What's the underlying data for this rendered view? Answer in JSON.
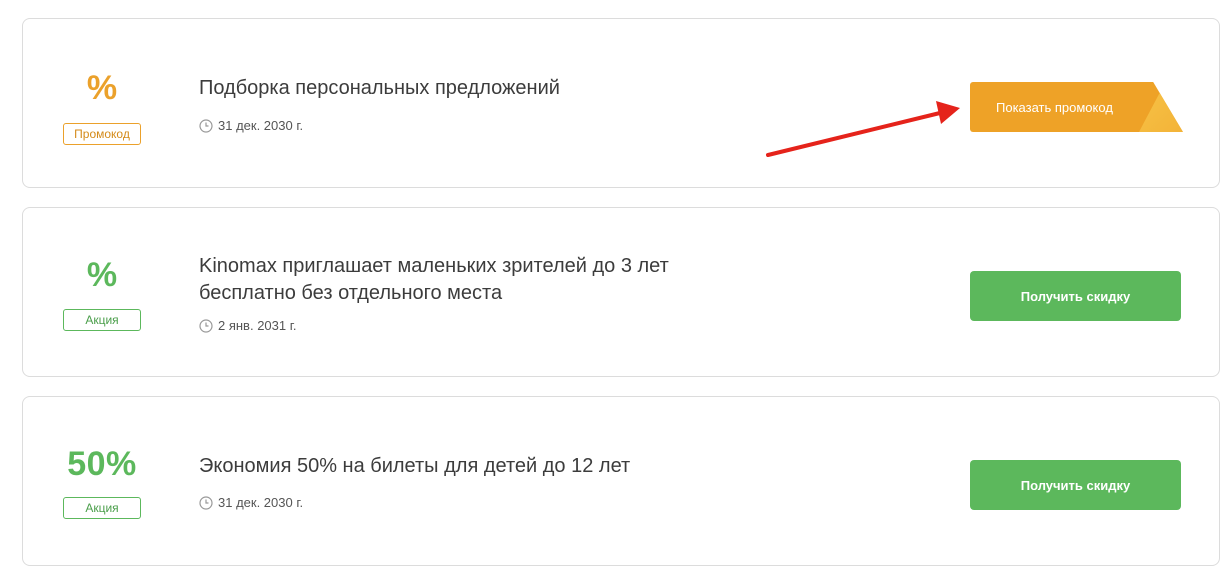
{
  "offers": [
    {
      "value": "%",
      "badge": "Промокод",
      "title": "Подборка персональных предложений",
      "date": "31 дек. 2030 г.",
      "button": "Показать промокод",
      "color": "#eba12b"
    },
    {
      "value": "%",
      "badge": "Акция",
      "title_line1": "Kinomax приглашает маленьких зрителей до 3 лет",
      "title_line2": "бесплатно без отдельного места",
      "date": "2 янв. 2031 г.",
      "button": "Получить скидку",
      "color": "#5cb85c"
    },
    {
      "value": "50%",
      "badge": "Акция",
      "title": "Экономия 50% на билеты для детей до 12 лет",
      "date": "31 дек. 2030 г.",
      "button": "Получить скидку",
      "color": "#5cb85c"
    }
  ],
  "icons": {
    "clock": "clock-icon",
    "arrow": "red-arrow-annotation"
  }
}
